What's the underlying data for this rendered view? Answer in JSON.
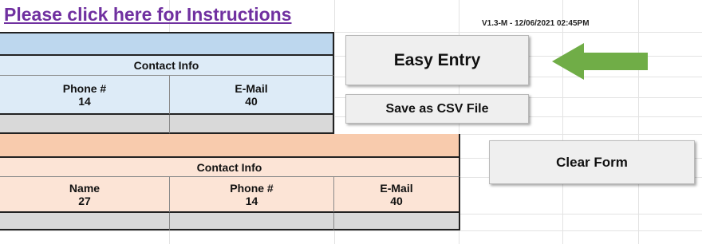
{
  "header": {
    "instructions_link": "Please click here for Instructions",
    "version": "V1.3-M - 12/06/2021 02:45PM"
  },
  "table_top": {
    "section_title": "Contact Info",
    "columns": [
      {
        "label": "Phone #",
        "max_length": "14"
      },
      {
        "label": "E-Mail",
        "max_length": "40"
      }
    ]
  },
  "table_bottom": {
    "section_title": "Contact Info",
    "columns": [
      {
        "label": "Name",
        "max_length": "27"
      },
      {
        "label": "Phone #",
        "max_length": "14"
      },
      {
        "label": "E-Mail",
        "max_length": "40"
      }
    ]
  },
  "buttons": {
    "easy_entry": "Easy Entry",
    "save_csv": "Save as CSV File",
    "clear_form": "Clear Form"
  },
  "icons": {
    "arrow": "left-arrow-icon"
  },
  "colors": {
    "blue_fill": "#ddebf7",
    "blue_band": "#bdd7ee",
    "peach_fill": "#fce4d6",
    "peach_band": "#f8cbad",
    "gray_row": "#d9d9d9",
    "arrow_green": "#70ad47",
    "link_purple": "#7030a0"
  }
}
